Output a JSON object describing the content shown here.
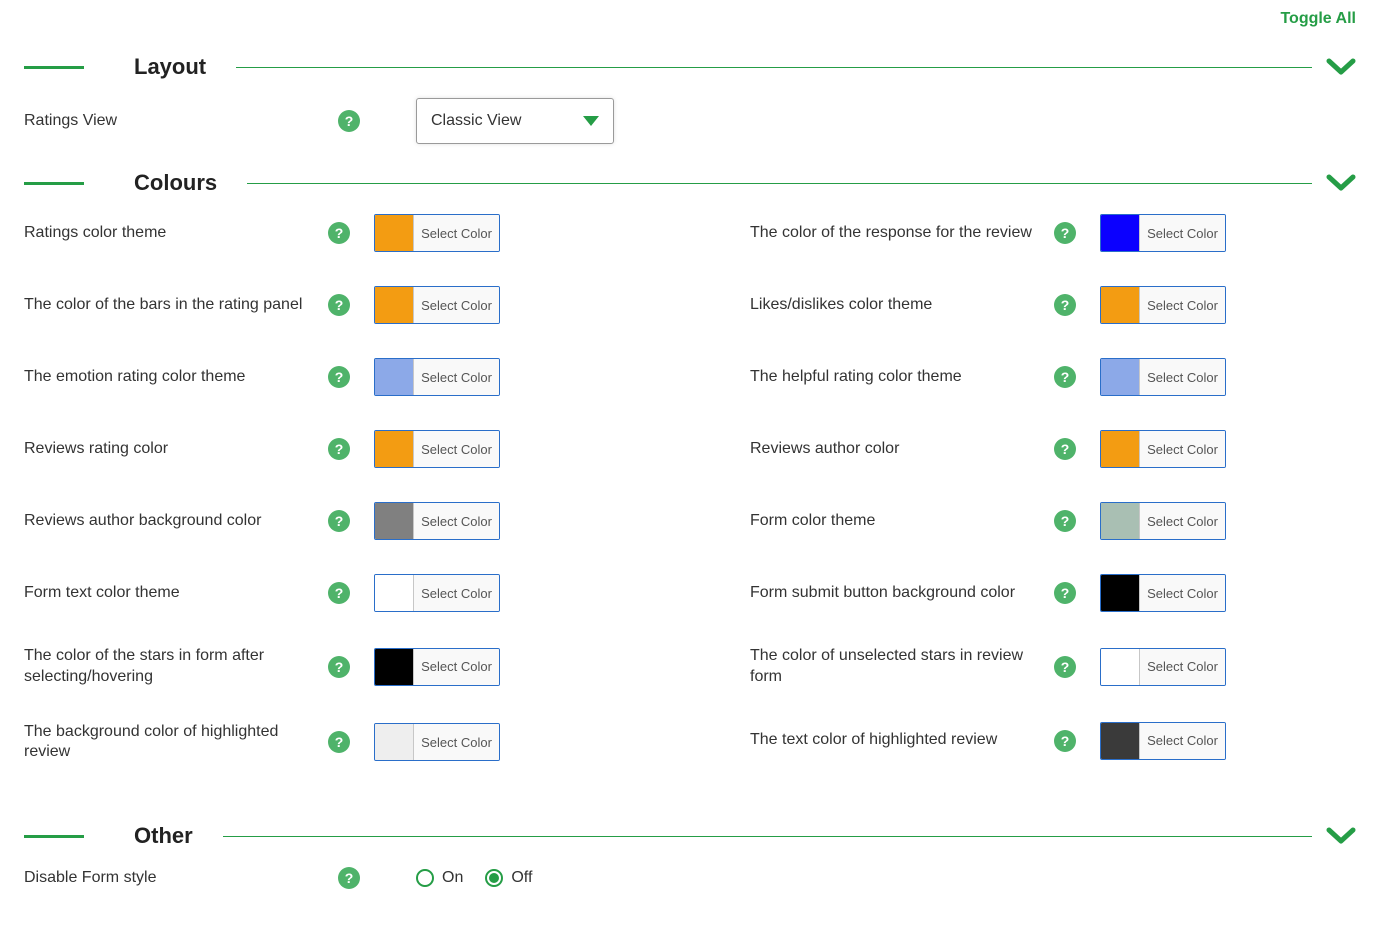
{
  "toggle_all": "Toggle All",
  "section_layout": "Layout",
  "section_colours": "Colours",
  "section_other": "Other",
  "select_color_label": "Select Color",
  "layout": {
    "ratings_view_label": "Ratings View",
    "ratings_view_value": "Classic View"
  },
  "colours": {
    "left": [
      {
        "label": "Ratings color theme",
        "color": "#f39c12"
      },
      {
        "label": "The color of the bars in the rating panel",
        "color": "#f39c12"
      },
      {
        "label": "The emotion rating color theme",
        "color": "#8ca9e8"
      },
      {
        "label": "Reviews rating color",
        "color": "#f39c12"
      },
      {
        "label": "Reviews author background color",
        "color": "#808080"
      },
      {
        "label": "Form text color theme",
        "color": "#ffffff"
      },
      {
        "label": "The color of the stars in form after selecting/hovering",
        "color": "#000000"
      },
      {
        "label": "The background color of highlighted review",
        "color": "#eeeeee"
      }
    ],
    "right": [
      {
        "label": "The color of the response for the review",
        "color": "#0b00ff"
      },
      {
        "label": "Likes/dislikes color theme",
        "color": "#f39c12"
      },
      {
        "label": "The helpful rating color theme",
        "color": "#8ca9e8"
      },
      {
        "label": "Reviews author color",
        "color": "#f39c12"
      },
      {
        "label": "Form color theme",
        "color": "#a9bfb3"
      },
      {
        "label": "Form submit button background color",
        "color": "#000000"
      },
      {
        "label": "The color of unselected stars in review form",
        "color": "#ffffff"
      },
      {
        "label": "The text color of highlighted review",
        "color": "#3a3a3a"
      }
    ]
  },
  "other": {
    "disable_form_label": "Disable Form style",
    "on_label": "On",
    "off_label": "Off",
    "value": "Off"
  }
}
